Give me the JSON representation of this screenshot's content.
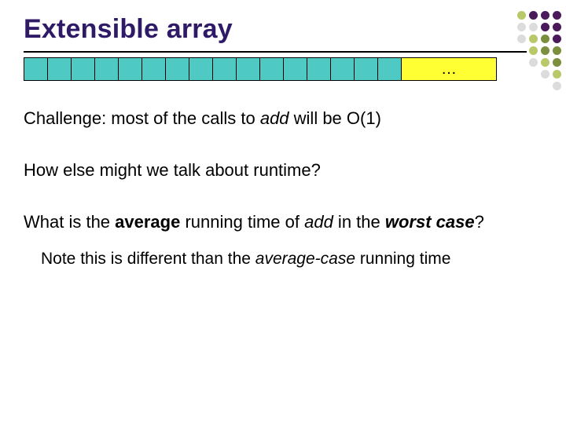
{
  "title": "Extensible array",
  "array": {
    "cell_count": 16,
    "cell_color": "#4ec9c3",
    "more_label": "…",
    "more_color": "#ffff33"
  },
  "body": {
    "p1_a": "Challenge: most of the calls to ",
    "p1_add": "add",
    "p1_b": " will be O(1)",
    "p2": "How else might we talk about runtime?",
    "p3_a": "What is the ",
    "p3_avg": "average",
    "p3_b": " running time of ",
    "p3_add": "add",
    "p3_c": " in the ",
    "p3_worst": "worst case",
    "p3_d": "?",
    "note_a": "Note this is different than the ",
    "note_ac": "average-case",
    "note_b": " running time"
  }
}
